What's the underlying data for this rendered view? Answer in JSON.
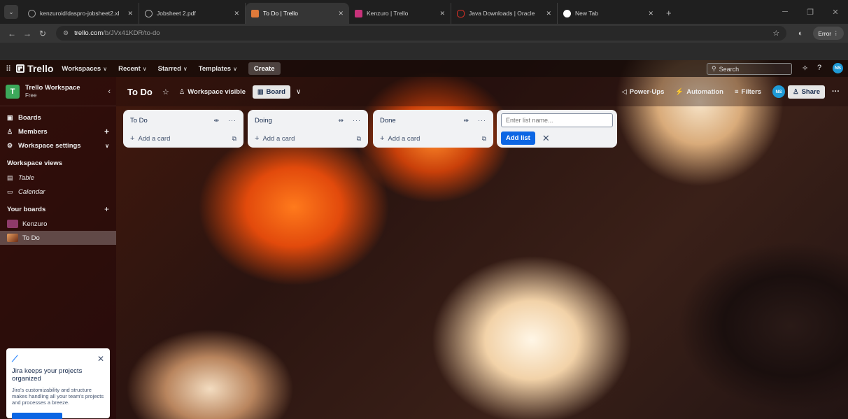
{
  "browser": {
    "tabs": [
      {
        "title": "kenzuroid/daspro-jobsheet2.xl",
        "favicon_color": "#666666",
        "active": false
      },
      {
        "title": "Jobsheet 2.pdf",
        "favicon_color": "#777777",
        "active": false
      },
      {
        "title": "To Do | Trello",
        "favicon_color": "#e07a3a",
        "active": true
      },
      {
        "title": "Kenzuro | Trello",
        "favicon_color": "#c8327a",
        "active": false
      },
      {
        "title": "Java Downloads | Oracle",
        "favicon_color": "#d93025",
        "active": false
      },
      {
        "title": "New Tab",
        "favicon_color": "#ffffff",
        "active": false
      }
    ],
    "url_host": "trello.com",
    "url_path": "/b/JVx41KDR/to-do",
    "error_label": "Error"
  },
  "header": {
    "logo": "Trello",
    "menus": [
      "Workspaces",
      "Recent",
      "Starred",
      "Templates"
    ],
    "create_label": "Create",
    "search_placeholder": "Search",
    "avatar_initials": "NS"
  },
  "sidebar": {
    "workspace_badge": "T",
    "workspace_name": "Trello Workspace",
    "workspace_plan": "Free",
    "items": [
      {
        "label": "Boards"
      },
      {
        "label": "Members"
      },
      {
        "label": "Workspace settings"
      }
    ],
    "views_heading": "Workspace views",
    "views": [
      {
        "label": "Table"
      },
      {
        "label": "Calendar"
      }
    ],
    "boards_heading": "Your boards",
    "boards": [
      {
        "label": "Kenzuro",
        "color": "#8e3b6a",
        "active": false
      },
      {
        "label": "To Do",
        "color": "#b5562c",
        "active": true
      }
    ]
  },
  "jira_promo": {
    "title": "Jira keeps your projects organized",
    "body": "Jira's customizability and structure makes handling all your team's projects and processes a breeze."
  },
  "board": {
    "title": "To Do",
    "visibility": "Workspace visible",
    "view_label": "Board",
    "powerups_label": "Power-Ups",
    "automation_label": "Automation",
    "filters_label": "Filters",
    "member_initials": "NS",
    "share_label": "Share",
    "lists": [
      {
        "title": "To Do",
        "add_card_label": "Add a card"
      },
      {
        "title": "Doing",
        "add_card_label": "Add a card"
      },
      {
        "title": "Done",
        "add_card_label": "Add a card"
      }
    ],
    "new_list_placeholder": "Enter list name...",
    "add_list_label": "Add list"
  }
}
